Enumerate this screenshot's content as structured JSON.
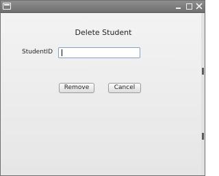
{
  "window": {
    "title": "",
    "controls": {
      "minimize_icon": "minimize-icon",
      "maximize_icon": "maximize-icon",
      "close_icon": "close-icon"
    }
  },
  "dialog": {
    "heading": "Delete Student",
    "student_id_label": "StudentID",
    "student_id_value": "",
    "remove_label": "Remove",
    "cancel_label": "Cancel"
  },
  "colors": {
    "titlebar": "#7f7f7f",
    "background": "#ececec",
    "input_border": "#7fa3c7"
  }
}
